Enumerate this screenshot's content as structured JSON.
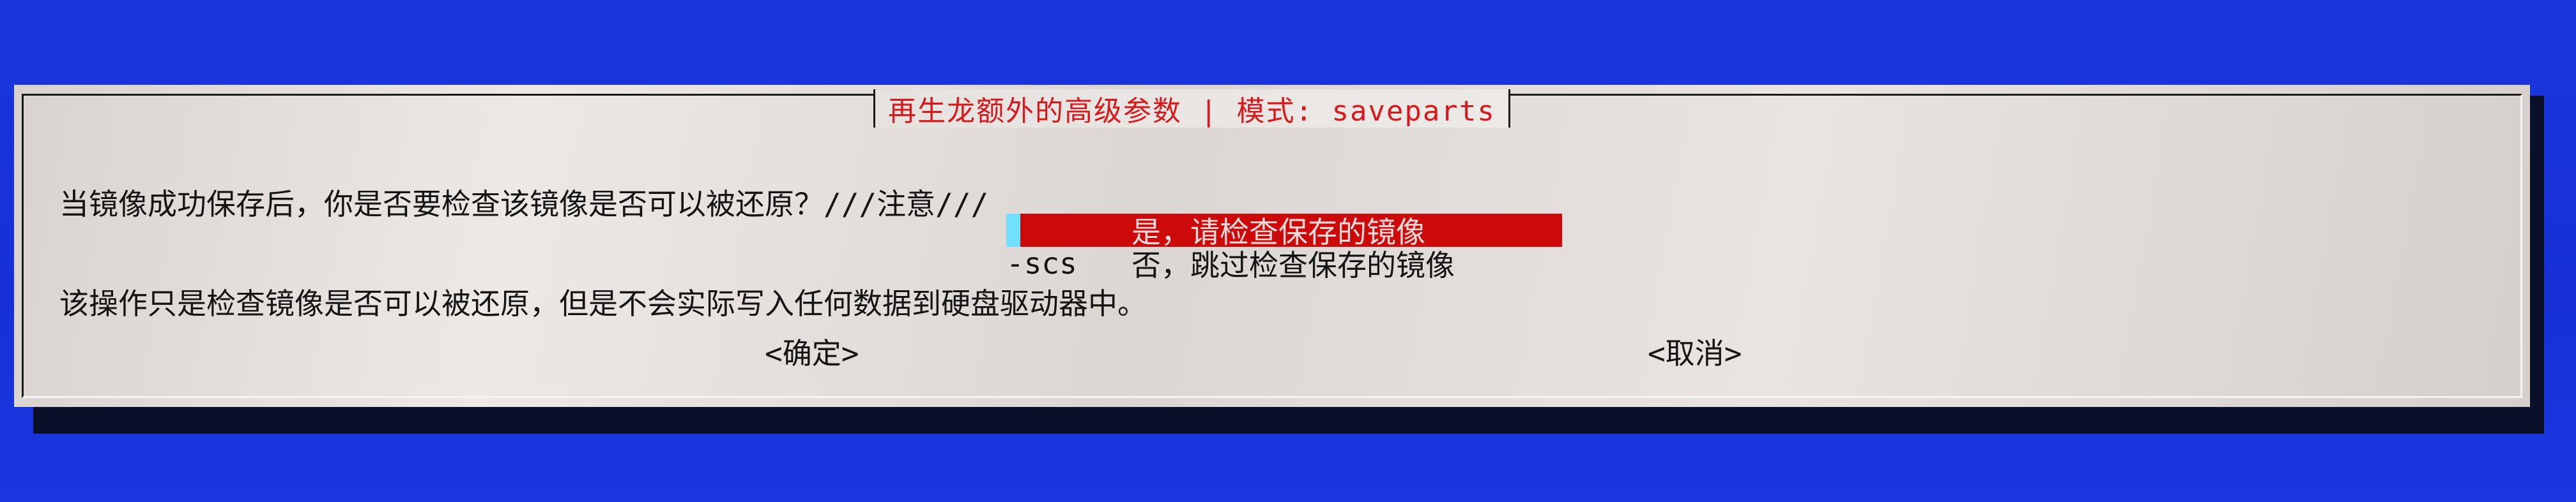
{
  "dialog": {
    "title": "再生龙额外的高级参数 | 模式: saveparts",
    "message_line1": "当镜像成功保存后，你是否要检查该镜像是否可以被还原？///注意///",
    "message_line2": "该操作只是检查镜像是否可以被还原，但是不会实际写入任何数据到硬盘驱动器中。"
  },
  "menu": {
    "items": [
      {
        "tag": "",
        "label": "是，请检查保存的镜像",
        "selected": true
      },
      {
        "tag": "-scs",
        "label": "否，跳过检查保存的镜像",
        "selected": false
      }
    ]
  },
  "buttons": {
    "ok": "<确定>",
    "cancel": "<取消>"
  },
  "colors": {
    "background": "#1733d9",
    "dialog": "#e4e0dd",
    "title": "#d8191b",
    "selected_row": "#cd0a0a",
    "cursor": "#6fe0ff"
  }
}
